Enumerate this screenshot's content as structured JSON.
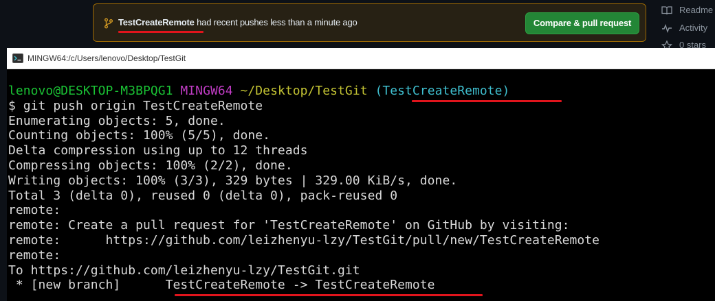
{
  "github": {
    "banner": {
      "branch_icon": "git-branch-icon",
      "branch_name": "TestCreateRemote",
      "message": " had recent pushes less than a minute ago",
      "compare_button_label": "Compare & pull request",
      "colors": {
        "banner_border": "#9e6a03",
        "button_bg": "#238636",
        "annotation_red": "#e0141c"
      }
    },
    "sidebar": {
      "readme_icon": "book-icon",
      "readme_label": "Readme",
      "activity_icon": "pulse-icon",
      "activity_label": "Activity",
      "stars_icon": "star-icon",
      "stars_label": "0 stars"
    }
  },
  "terminal": {
    "window_icon": "mintty-icon",
    "title": "MINGW64:/c/Users/lenovo/Desktop/TestGit",
    "prompt": {
      "user_host": "lenovo@DESKTOP-M3BPQG1",
      "system": "MINGW64",
      "path": "~/Desktop/TestGit",
      "branch": "(TestCreateRemote)"
    },
    "command": "$ git push origin TestCreateRemote",
    "output_lines": [
      "Enumerating objects: 5, done.",
      "Counting objects: 100% (5/5), done.",
      "Delta compression using up to 12 threads",
      "Compressing objects: 100% (2/2), done.",
      "Writing objects: 100% (3/3), 329 bytes | 329.00 KiB/s, done.",
      "Total 3 (delta 0), reused 0 (delta 0), pack-reused 0",
      "remote:",
      "remote: Create a pull request for 'TestCreateRemote' on GitHub by visiting:",
      "remote:      https://github.com/leizhenyu-lzy/TestGit/pull/new/TestCreateRemote",
      "remote:",
      "To https://github.com/leizhenyu-lzy/TestGit.git"
    ],
    "last_line_prefix": " * [new branch]      ",
    "last_line_mapping": "TestCreateRemote -> TestCreateRemote",
    "colors": {
      "background": "#000000",
      "text": "#d9d9d9",
      "user_host": "#1ac234",
      "system": "#c03cc4",
      "path": "#c3c333",
      "branch": "#3fbfcf"
    }
  }
}
